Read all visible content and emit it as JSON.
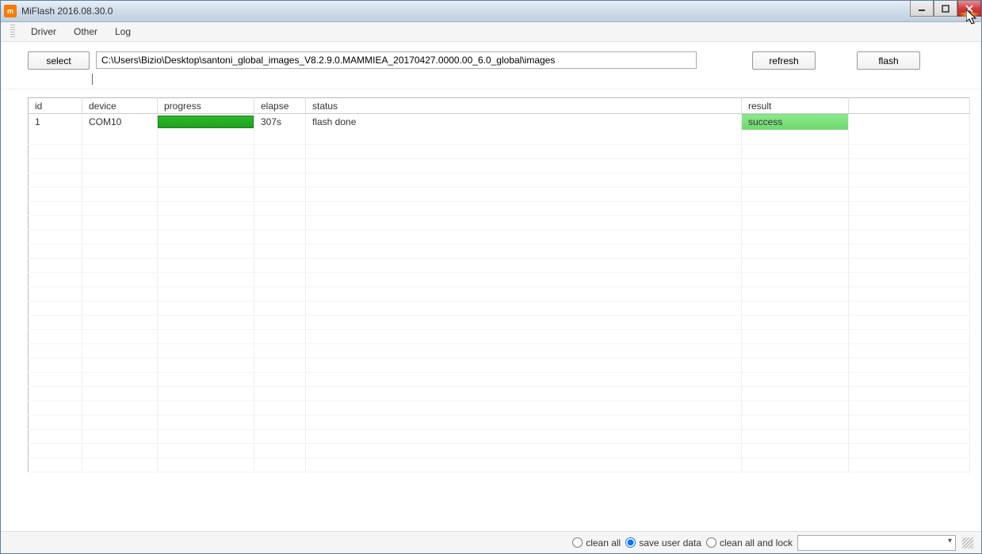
{
  "title": "MiFlash 2016.08.30.0",
  "titlebar_icon": "m",
  "menu": {
    "driver": "Driver",
    "other": "Other",
    "log": "Log"
  },
  "toolbar": {
    "select_label": "select",
    "path": "C:\\Users\\Bizio\\Desktop\\santoni_global_images_V8.2.9.0.MAMMIEA_20170427.0000.00_6.0_global\\images",
    "refresh_label": "refresh",
    "flash_label": "flash"
  },
  "table": {
    "headers": {
      "id": "id",
      "device": "device",
      "progress": "progress",
      "elapse": "elapse",
      "status": "status",
      "result": "result"
    },
    "rows": [
      {
        "id": "1",
        "device": "COM10",
        "progress_pct": 100,
        "elapse": "307s",
        "status": "flash done",
        "result": "success"
      }
    ]
  },
  "statusbar": {
    "options": {
      "clean_all": "clean all",
      "save_user_data": "save user data",
      "clean_all_and_lock": "clean all and lock"
    },
    "selected_option": "save_user_data"
  }
}
